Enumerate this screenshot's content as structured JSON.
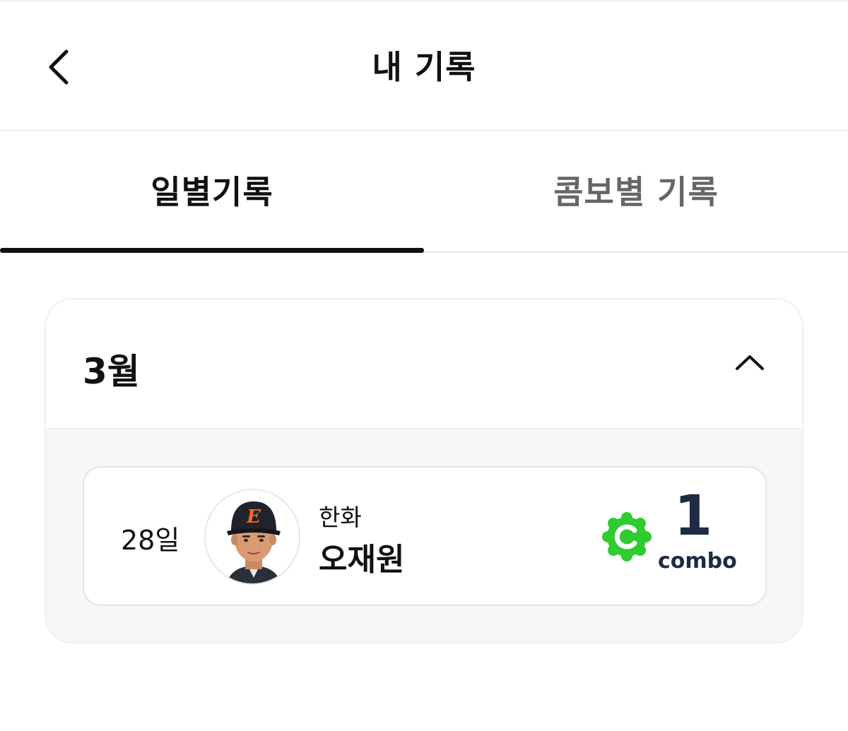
{
  "header": {
    "title": "내 기록",
    "back_icon": "chevron-left-icon"
  },
  "tabs": [
    {
      "label": "일별기록",
      "active": true
    },
    {
      "label": "콤보별 기록",
      "active": false
    }
  ],
  "month_section": {
    "title": "3월",
    "expanded": true,
    "toggle_icon": "chevron-up-icon",
    "records": [
      {
        "day": "28일",
        "team": "한화",
        "player": "오재원",
        "combo_count": "1",
        "combo_label": "combo",
        "badge_icon": "combo-c-badge-icon",
        "badge_color": "#2ecc2e"
      }
    ]
  }
}
